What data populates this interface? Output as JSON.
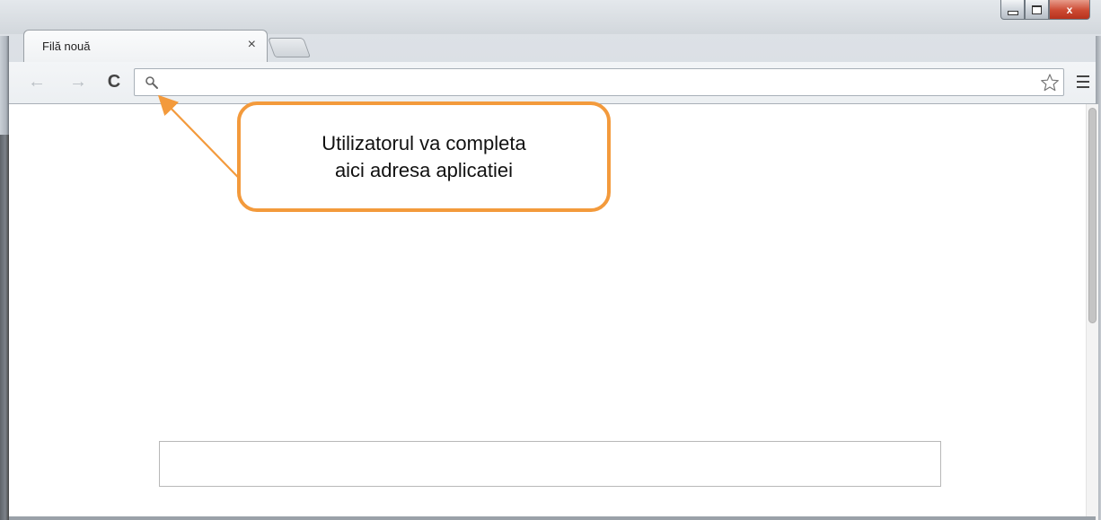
{
  "window": {
    "controls": {
      "minimize": "",
      "maximize": "",
      "close": "x"
    }
  },
  "tab": {
    "title": "Filă nouă",
    "close_glyph": "×"
  },
  "toolbar": {
    "back_icon": "back-arrow-icon",
    "forward_icon": "forward-arrow-icon",
    "reload_icon": "reload-icon",
    "back_glyph": "←",
    "forward_glyph": "→",
    "reload_glyph": "C"
  },
  "omnibox": {
    "value": "",
    "icon": "search-icon"
  },
  "callout": {
    "line1": "Utilizatorul va completa",
    "line2": "aici adresa aplicatiei",
    "border_color": "#f39a3c"
  },
  "page_search": {
    "value": ""
  }
}
